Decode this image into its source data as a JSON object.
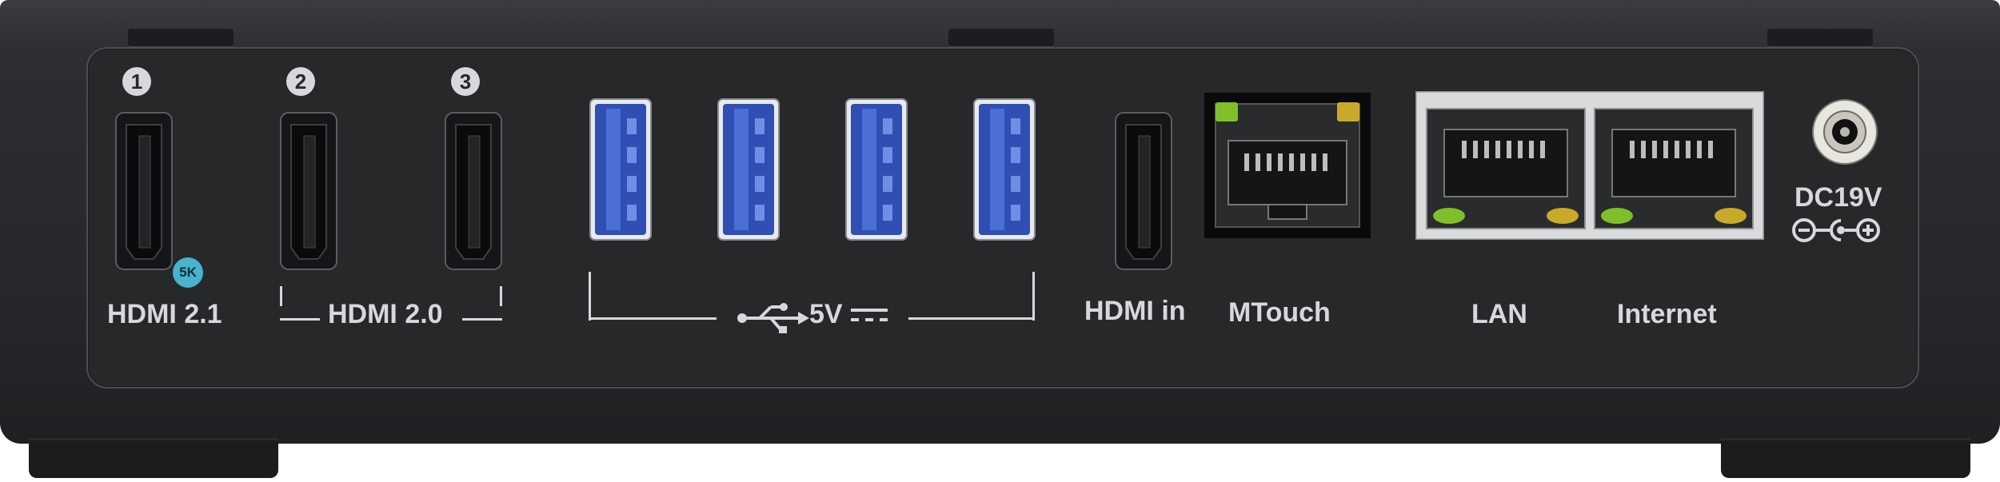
{
  "ports": {
    "hdmi_out_1": {
      "number": "1",
      "badge": "5K",
      "label": "HDMI 2.1"
    },
    "hdmi_out_2": {
      "number": "2"
    },
    "hdmi_out_3": {
      "number": "3"
    },
    "hdmi_group_label": "HDMI 2.0",
    "usb_label": "5V",
    "usb_count": 4,
    "hdmi_in_label": "HDMI in",
    "mtouch_label": "MTouch",
    "lan_label": "LAN",
    "internet_label": "Internet",
    "power_label": "DC19V"
  },
  "colors": {
    "body": "#25272a",
    "panel_border": "#4b4e52",
    "label_text": "#d6d8db",
    "badge": "#49b2cd",
    "usb_blue": "#2f4fb3",
    "led_green": "#7fbf2a",
    "led_amber": "#c9a92a"
  },
  "icons": {
    "usb": "usb-icon",
    "dc": "dc-polarity-icon"
  }
}
